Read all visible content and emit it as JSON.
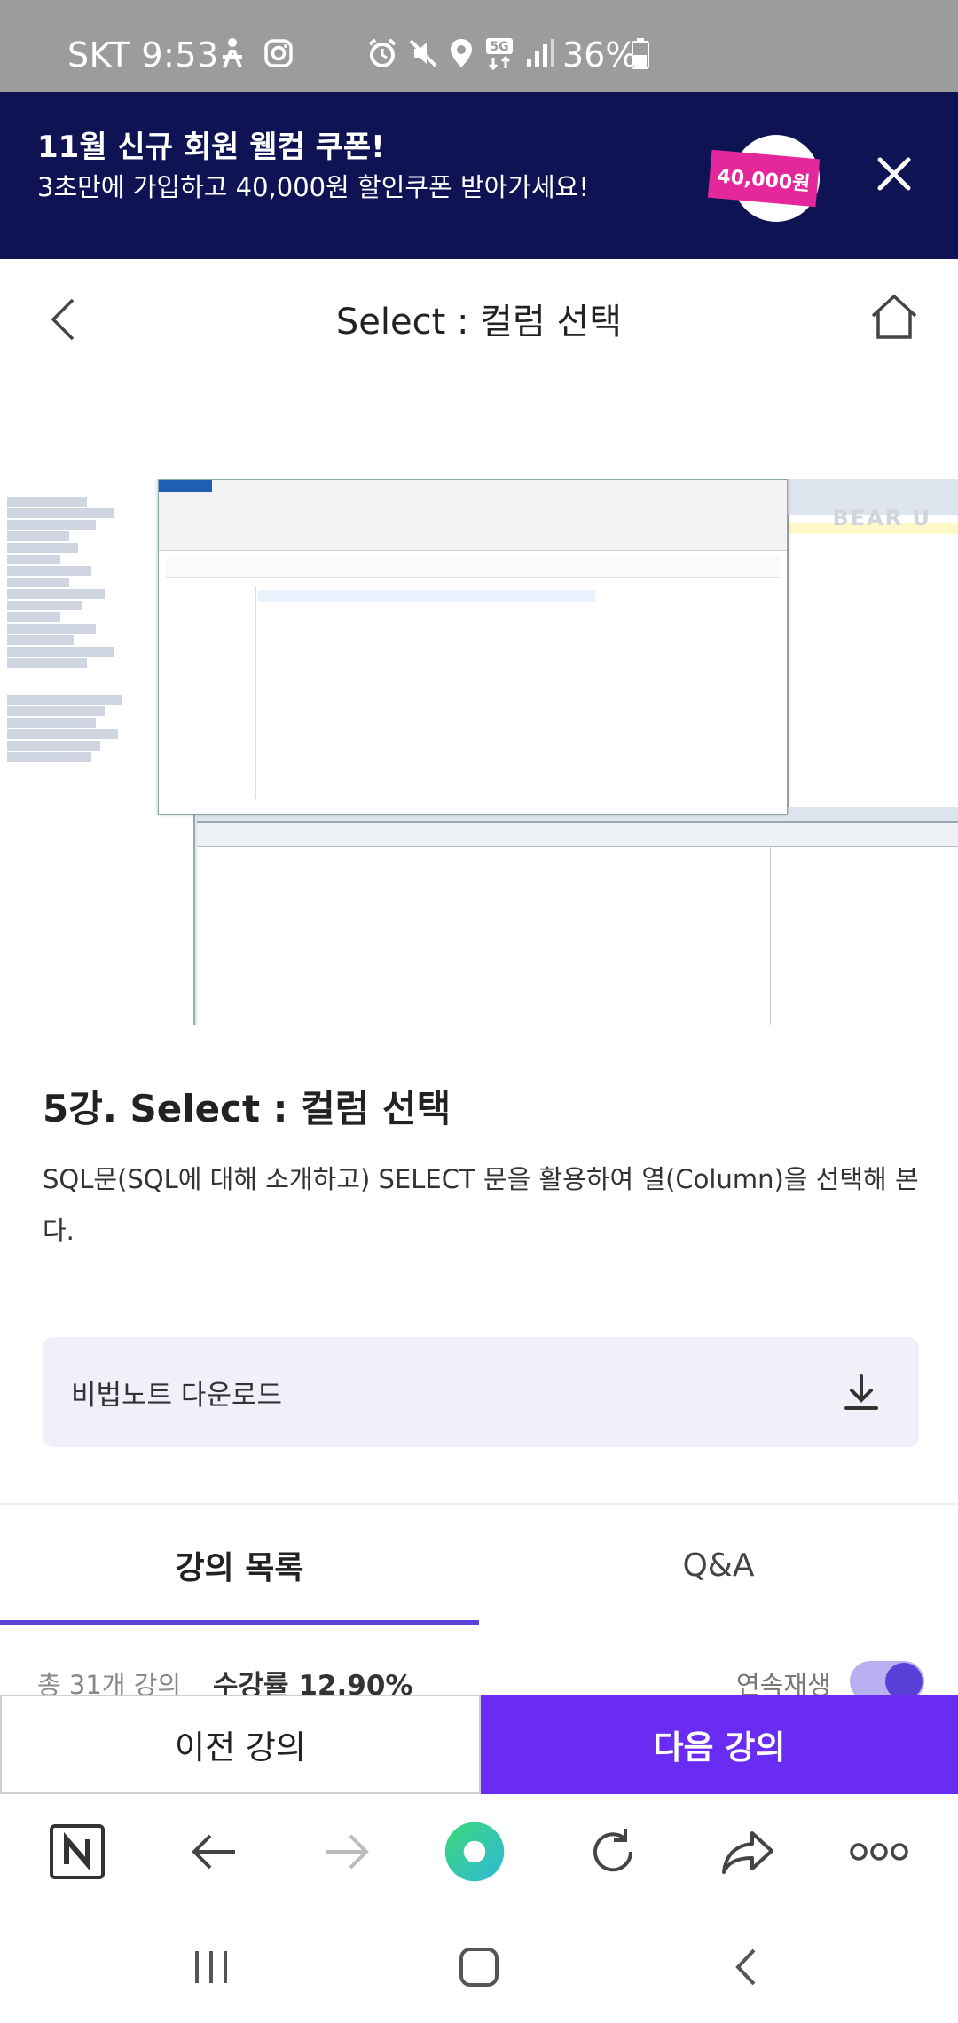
{
  "status_bar": {
    "carrier_time": "SKT 9:53",
    "battery": "36%",
    "network": "5G"
  },
  "promo": {
    "title": "11월 신규 회원 웰컴 쿠폰!",
    "subtitle": "3초만에 가입하고 40,000원 할인쿠폰 받아가세요!",
    "coupon_label": "40,000원"
  },
  "header": {
    "title": "Select : 컬럼 선택"
  },
  "video": {
    "watermark": "BEAR U"
  },
  "lecture": {
    "title": "5강. Select : 컬럼 선택",
    "description": "SQL문(SQL에 대해 소개하고) SELECT 문을 활용하여 열(Column)을 선택해 본다."
  },
  "note": {
    "label": "비법노트 다운로드"
  },
  "tabs": [
    {
      "label": "강의 목록",
      "active": true
    },
    {
      "label": "Q&A",
      "active": false
    }
  ],
  "info_row": {
    "total": "총 31개 강의",
    "rate": "수강률 12.90%",
    "autoplay": "연속재생",
    "autoplay_on": true
  },
  "actions": {
    "prev": "이전 강의",
    "next": "다음 강의"
  },
  "colors": {
    "accent": "#6a2cf3",
    "banner": "#0f1354",
    "coupon": "#e4279b"
  }
}
